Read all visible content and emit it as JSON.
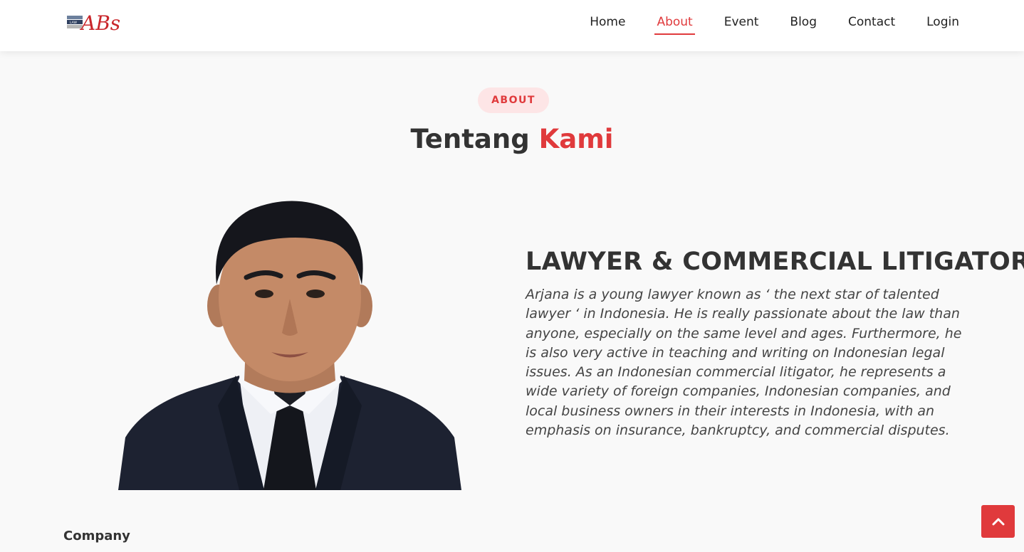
{
  "brand": {
    "logo_text": "ABs",
    "logo_badge_text": "LAW"
  },
  "nav": {
    "items": [
      {
        "label": "Home",
        "active": false
      },
      {
        "label": "About",
        "active": true
      },
      {
        "label": "Event",
        "active": false
      },
      {
        "label": "Blog",
        "active": false
      },
      {
        "label": "Contact",
        "active": false
      },
      {
        "label": "Login",
        "active": false
      }
    ]
  },
  "section": {
    "badge": "ABOUT",
    "title_main": "Tentang ",
    "title_accent": "Kami"
  },
  "about": {
    "heading": "LAWYER & COMMERCIAL LITIGATOR",
    "paragraph": "Arjana is a young lawyer known as ‘ the next star of talented lawyer ‘ in Indonesia. He is really passionate about the law than anyone, especially on the same level and ages. Furthermore, he is also very active in teaching and writing on Indonesian legal issues. As an Indonesian commercial litigator, he represents a wide variety of foreign companies, Indonesian companies, and local business owners in their interests in Indonesia, with an emphasis on insurance, bankruptcy, and commercial disputes."
  },
  "footer_section": {
    "company_label": "Company"
  },
  "colors": {
    "accent": "#e03a3c",
    "badge_bg": "#fde5e6",
    "page_bg": "#f9f9f9",
    "text": "#333333"
  },
  "icons": {
    "back_to_top": "chevron-up-icon",
    "portrait": "lawyer-portrait"
  }
}
